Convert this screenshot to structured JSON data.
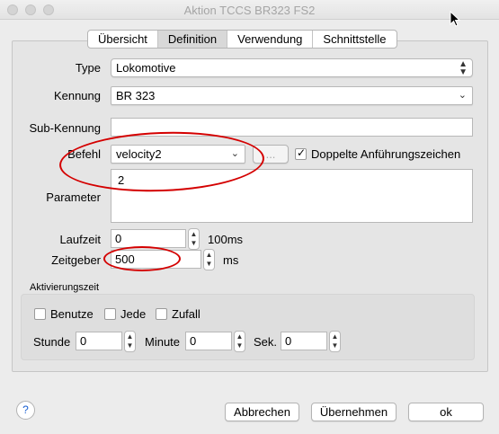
{
  "window": {
    "title": "Aktion TCCS BR323 FS2"
  },
  "tabs": [
    {
      "label": "Übersicht"
    },
    {
      "label": "Definition"
    },
    {
      "label": "Verwendung"
    },
    {
      "label": "Schnittstelle"
    }
  ],
  "form": {
    "type": {
      "label": "Type",
      "value": "Lokomotive"
    },
    "kennung": {
      "label": "Kennung",
      "value": "BR 323"
    },
    "subkennung": {
      "label": "Sub-Kennung",
      "value": ""
    },
    "befehl": {
      "label": "Befehl",
      "value": "velocity2",
      "dots_label": "...",
      "doppelte_label": "Doppelte Anführungszeichen",
      "doppelte_checked": true
    },
    "parameter": {
      "label": "Parameter",
      "value": "2"
    },
    "laufzeit": {
      "label": "Laufzeit",
      "value": "0",
      "unit": "100ms"
    },
    "zeitgeber": {
      "label": "Zeitgeber",
      "value": "500",
      "unit": "ms"
    }
  },
  "aktivierung": {
    "title": "Aktivierungszeit",
    "benutze": "Benutze",
    "jede": "Jede",
    "zufall": "Zufall",
    "stunde": {
      "label": "Stunde",
      "value": "0"
    },
    "minute": {
      "label": "Minute",
      "value": "0"
    },
    "sek": {
      "label": "Sek.",
      "value": "0"
    }
  },
  "buttons": {
    "help": "?",
    "abbrechen": "Abbrechen",
    "uebernehmen": "Übernehmen",
    "ok": "ok"
  },
  "colors": {
    "annotation_red": "#d40000",
    "tab_active": "#d8d8d8"
  }
}
